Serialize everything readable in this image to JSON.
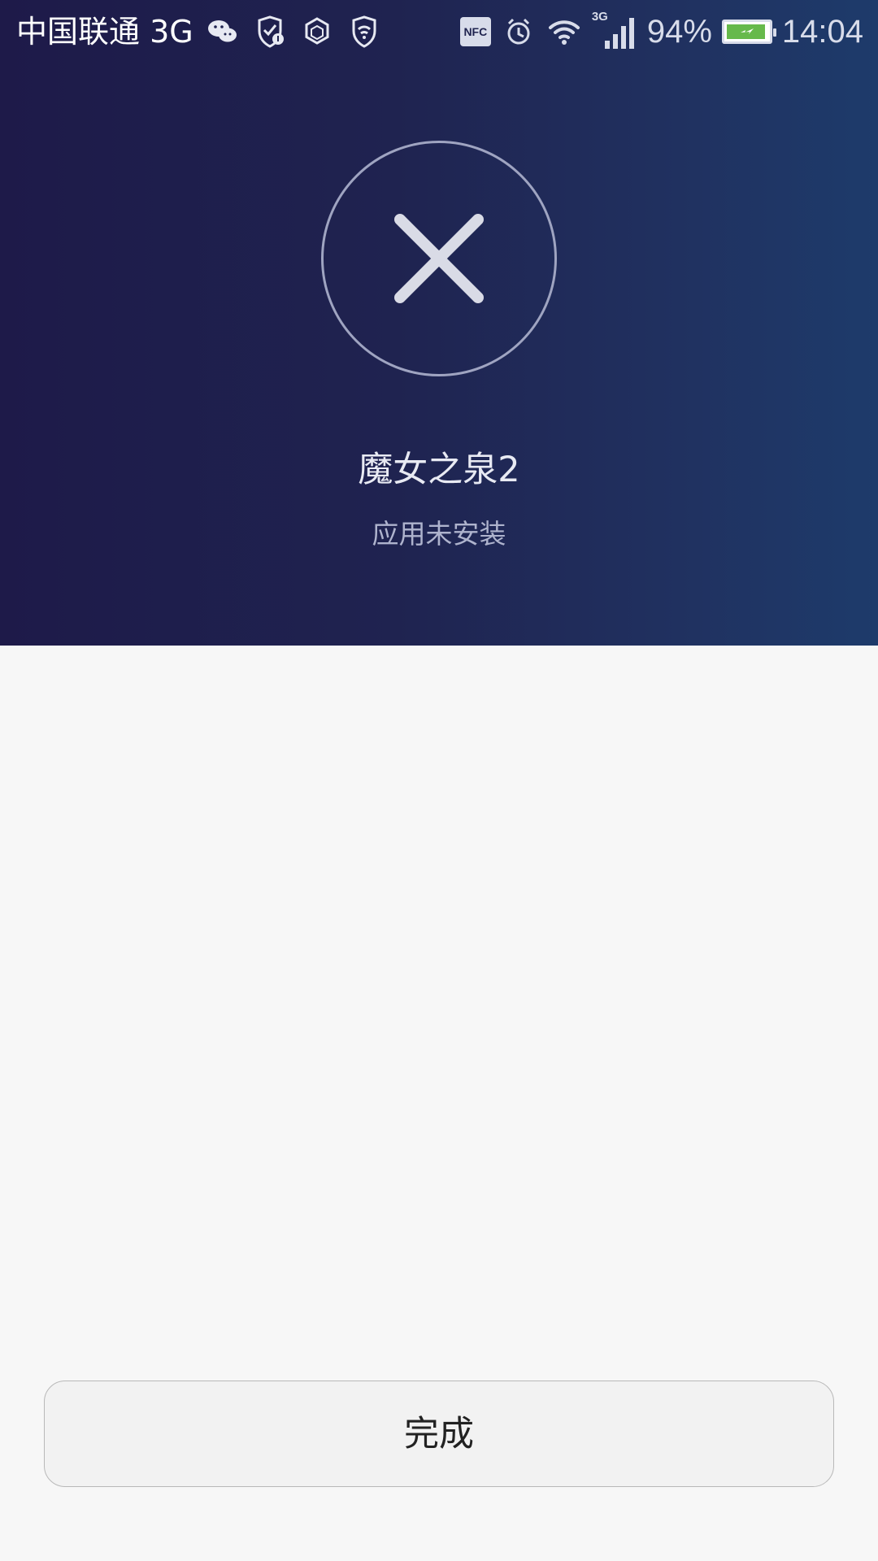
{
  "status_bar": {
    "carrier": "中国联通 3G",
    "network_label": "3G",
    "nfc_label": "NFC",
    "battery_percent": "94%",
    "battery_level": 0.94,
    "time": "14:04",
    "icons": {
      "wechat": "wechat-icon",
      "security": "shield-notification-icon",
      "hex": "hexagon-icon",
      "vpn": "wifi-shield-icon",
      "alarm": "alarm-icon",
      "wifi": "wifi-icon",
      "signal": "signal-icon"
    }
  },
  "result": {
    "app_name": "魔女之泉2",
    "message": "应用未安装",
    "icon": "close-icon"
  },
  "actions": {
    "done_label": "完成"
  },
  "colors": {
    "header_gradient_start": "#1e1a49",
    "header_gradient_end": "#1e3b6b",
    "background": "#f7f7f7",
    "button_background": "#f2f2f2",
    "battery_fill": "#66b94b"
  }
}
